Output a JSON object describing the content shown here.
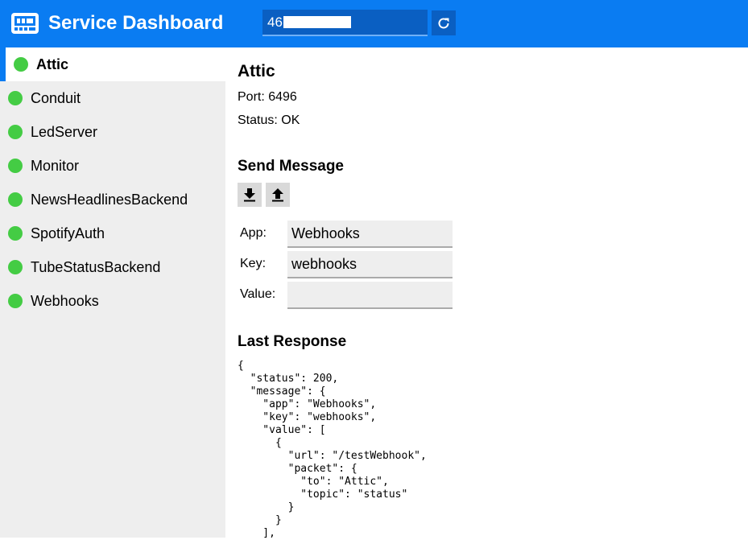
{
  "header": {
    "title": "Service Dashboard",
    "ip_value": "46.",
    "ip_placeholder": ""
  },
  "sidebar": {
    "items": [
      {
        "label": "Attic",
        "status": "ok",
        "active": true
      },
      {
        "label": "Conduit",
        "status": "ok",
        "active": false
      },
      {
        "label": "LedServer",
        "status": "ok",
        "active": false
      },
      {
        "label": "Monitor",
        "status": "ok",
        "active": false
      },
      {
        "label": "NewsHeadlinesBackend",
        "status": "ok",
        "active": false
      },
      {
        "label": "SpotifyAuth",
        "status": "ok",
        "active": false
      },
      {
        "label": "TubeStatusBackend",
        "status": "ok",
        "active": false
      },
      {
        "label": "Webhooks",
        "status": "ok",
        "active": false
      }
    ]
  },
  "service": {
    "name": "Attic",
    "port": "Port: 6496",
    "status": "Status: OK"
  },
  "send_message": {
    "title": "Send Message",
    "app_label": "App:",
    "app_value": "Webhooks",
    "key_label": "Key:",
    "key_value": "webhooks",
    "value_label": "Value:",
    "value_value": ""
  },
  "last_response": {
    "title": "Last Response",
    "body": "{\n  \"status\": 200,\n  \"message\": {\n    \"app\": \"Webhooks\",\n    \"key\": \"webhooks\",\n    \"value\": [\n      {\n        \"url\": \"/testWebhook\",\n        \"packet\": {\n          \"to\": \"Attic\",\n          \"topic\": \"status\"\n        }\n      }\n    ],"
  },
  "colors": {
    "header": "#0a7cf2",
    "status_ok": "#44cc44",
    "sidebar_bg": "#eeeeee"
  },
  "icons": {
    "logo": "server-board-icon",
    "refresh": "refresh-icon",
    "download": "download-icon",
    "upload": "upload-icon"
  }
}
